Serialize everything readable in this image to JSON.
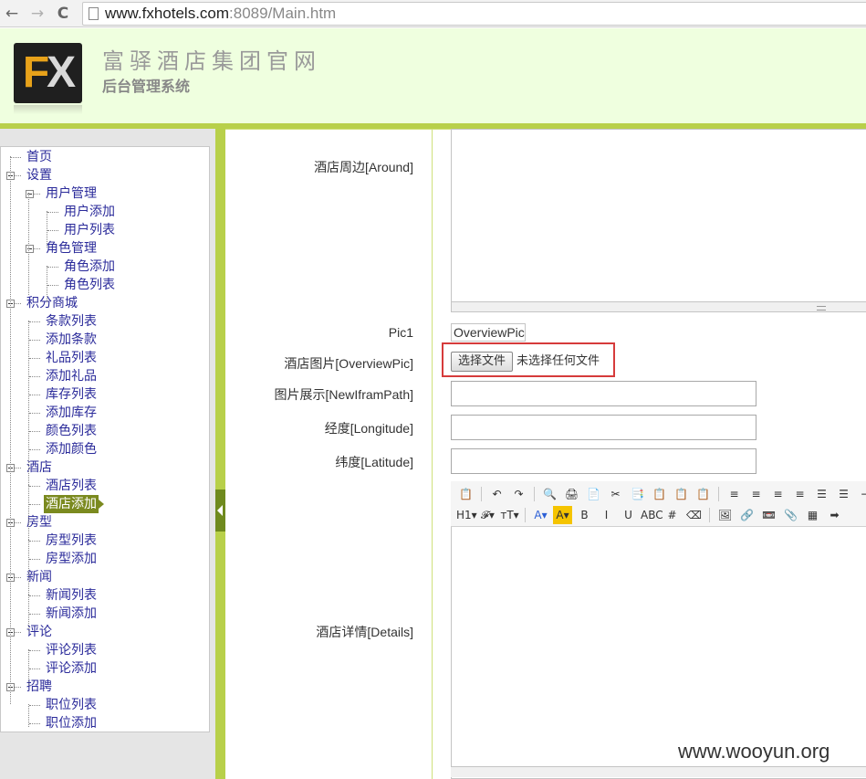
{
  "browser": {
    "url_host": "www.fxhotels.com",
    "url_rest": ":8089/Main.htm",
    "back_glyph": "←",
    "forward_glyph": "→",
    "reload_glyph": "C"
  },
  "header": {
    "logo_f": "F",
    "logo_x": "X",
    "title": "富驿酒店集团官网",
    "subtitle": "后台管理系统"
  },
  "sidebar": {
    "items": [
      {
        "label": "首页"
      },
      {
        "label": "设置"
      },
      {
        "label": "用户管理"
      },
      {
        "label": "用户添加"
      },
      {
        "label": "用户列表"
      },
      {
        "label": "角色管理"
      },
      {
        "label": "角色添加"
      },
      {
        "label": "角色列表"
      },
      {
        "label": "积分商城"
      },
      {
        "label": "条款列表"
      },
      {
        "label": "添加条款"
      },
      {
        "label": "礼品列表"
      },
      {
        "label": "添加礼品"
      },
      {
        "label": "库存列表"
      },
      {
        "label": "添加库存"
      },
      {
        "label": "颜色列表"
      },
      {
        "label": "添加颜色"
      },
      {
        "label": "酒店"
      },
      {
        "label": "酒店列表"
      },
      {
        "label": "酒店添加",
        "active": true
      },
      {
        "label": "房型"
      },
      {
        "label": "房型列表"
      },
      {
        "label": "房型添加"
      },
      {
        "label": "新闻"
      },
      {
        "label": "新闻列表"
      },
      {
        "label": "新闻添加"
      },
      {
        "label": "评论"
      },
      {
        "label": "评论列表"
      },
      {
        "label": "评论添加"
      },
      {
        "label": "招聘"
      },
      {
        "label": "职位列表"
      },
      {
        "label": "职位添加"
      }
    ]
  },
  "form": {
    "around_label": "酒店周边[Around]",
    "pic1_label": "Pic1",
    "pic1_value": "OverviewPic",
    "overview_label": "酒店图片[OverviewPic]",
    "file_button": "选择文件",
    "file_status": "未选择任何文件",
    "newfram_label": "图片展示[NewIframPath]",
    "longitude_label": "经度[Longitude]",
    "latitude_label": "纬度[Latitude]",
    "details_label": "酒店详情[Details]"
  },
  "toolbar": {
    "row1": [
      "📋",
      "|",
      "↶",
      "↷",
      "|",
      "🔍",
      "🖨",
      "📄",
      "✂",
      "📑",
      "📋",
      "📋",
      "📋",
      "|",
      "≡",
      "≡",
      "≡",
      "≡",
      "☰",
      "☰",
      "⇥"
    ],
    "row2": [
      "H1▾",
      "𝓕▾",
      "тT▾",
      "|",
      "A▾",
      "A▾",
      "B",
      "I",
      "U",
      "ABC",
      "#",
      "⌫",
      "|",
      "🖼",
      "🔗",
      "📼",
      "📎",
      "▦",
      "➡"
    ]
  },
  "watermark": "www.wooyun.org"
}
